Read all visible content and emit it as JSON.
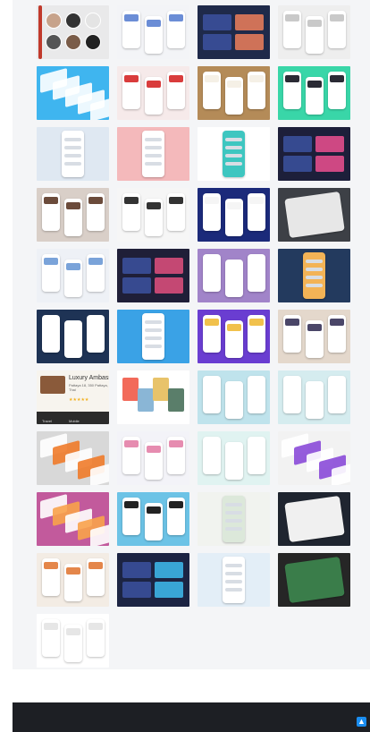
{
  "gallery": {
    "tiles": [
      {
        "name": "profile-circles-shot",
        "bg": "#e9e9ea",
        "accent": "#2a2a2a",
        "style": "circles"
      },
      {
        "name": "travel-cards-white-shot",
        "bg": "#f3f4f7",
        "accent": "#6b8dd6",
        "style": "phones"
      },
      {
        "name": "dark-mountain-app-shot",
        "bg": "#1f2a4a",
        "accent": "#e27a5a",
        "style": "dark"
      },
      {
        "name": "light-list-app-shot",
        "bg": "#eeeeee",
        "accent": "#c9c9c9",
        "style": "phones"
      },
      {
        "name": "blue-isometric-app-shot",
        "bg": "#3fb5ef",
        "accent": "#ffffff",
        "style": "iso"
      },
      {
        "name": "red-header-app-shot",
        "bg": "#f6eaea",
        "accent": "#d93c3c",
        "style": "phones"
      },
      {
        "name": "wood-desk-phone-shot",
        "bg": "#b48b58",
        "accent": "#f5f0e6",
        "style": "phones"
      },
      {
        "name": "green-travel-app-shot",
        "bg": "#39d6a8",
        "accent": "#2b2b35",
        "style": "phones"
      },
      {
        "name": "pale-blue-single-phone-shot",
        "bg": "#dfe8f2",
        "accent": "#ffffff",
        "style": "single"
      },
      {
        "name": "pink-london-app-shot",
        "bg": "#f4b9bb",
        "accent": "#ffffff",
        "style": "single"
      },
      {
        "name": "white-map-app-shot",
        "bg": "#ffffff",
        "accent": "#3ec6c0",
        "style": "single"
      },
      {
        "name": "dark-city-cards-shot",
        "bg": "#1d1f3a",
        "accent": "#e24d8c",
        "style": "dark"
      },
      {
        "name": "photo-collage-phones-shot",
        "bg": "#d9cfc8",
        "accent": "#6b4b3b",
        "style": "phones"
      },
      {
        "name": "white-ui-cards-shot",
        "bg": "#f6f6f6",
        "accent": "#333333",
        "style": "phones"
      },
      {
        "name": "dark-blue-screens-shot",
        "bg": "#1b2a7a",
        "accent": "#f5f5f5",
        "style": "phones"
      },
      {
        "name": "tablet-dark-perspective-shot",
        "bg": "#3d4046",
        "accent": "#e7e7e7",
        "style": "tablet"
      },
      {
        "name": "light-minimal-phones-shot",
        "bg": "#eef1f6",
        "accent": "#7aa3d9",
        "style": "phones"
      },
      {
        "name": "dark-pink-header-shot",
        "bg": "#1f1f38",
        "accent": "#d64d7a",
        "style": "dark"
      },
      {
        "name": "purple-phone-pair-shot",
        "bg": "#a184c9",
        "accent": "#ffffff",
        "style": "phones"
      },
      {
        "name": "blue-night-city-shot",
        "bg": "#233a5e",
        "accent": "#f3b356",
        "style": "single"
      },
      {
        "name": "navy-white-phones-shot",
        "bg": "#1e3355",
        "accent": "#ffffff",
        "style": "phones"
      },
      {
        "name": "hand-holding-phone-shot",
        "bg": "#3aa2e6",
        "accent": "#ffffff",
        "style": "single"
      },
      {
        "name": "purple-colorful-blocks-shot",
        "bg": "#6a3dd1",
        "accent": "#f1c14c",
        "style": "phones"
      },
      {
        "name": "beige-cards-shot",
        "bg": "#e4d8cc",
        "accent": "#4a4668",
        "style": "phones"
      },
      {
        "name": "luxury-ambassador-shot",
        "bg": "#f7f4ee",
        "accent": "#333333",
        "style": "luxury"
      },
      {
        "name": "coral-photo-collage-shot",
        "bg": "#ffffff",
        "accent": "#f05a5a",
        "style": "collage"
      },
      {
        "name": "teal-island-app-shot",
        "bg": "#bfe3ec",
        "accent": "#ffffff",
        "style": "phones"
      },
      {
        "name": "map-teal-app-shot",
        "bg": "#d5ecef",
        "accent": "#ffffff",
        "style": "phones"
      },
      {
        "name": "colorful-iso-cards-shot",
        "bg": "#d8d8d8",
        "accent": "#f07b2a",
        "style": "iso"
      },
      {
        "name": "pink-white-cards-shot",
        "bg": "#f3f3f8",
        "accent": "#e68cb0",
        "style": "phones"
      },
      {
        "name": "white-mint-phones-shot",
        "bg": "#e0f3f1",
        "accent": "#ffffff",
        "style": "phones"
      },
      {
        "name": "purple-iso-grid-shot",
        "bg": "#f2f2f2",
        "accent": "#8a4ad8",
        "style": "iso"
      },
      {
        "name": "colorful-gradient-cards-shot",
        "bg": "#c25a9c",
        "accent": "#f8a24b",
        "style": "iso"
      },
      {
        "name": "light-blue-two-phones-shot",
        "bg": "#6cc3e6",
        "accent": "#222222",
        "style": "phones"
      },
      {
        "name": "white-palm-phone-shot",
        "bg": "#f1f3ef",
        "accent": "#dce8da",
        "style": "single"
      },
      {
        "name": "dark-laptop-shot",
        "bg": "#1f2530",
        "accent": "#f0f0f0",
        "style": "tablet"
      },
      {
        "name": "sunset-phones-shot",
        "bg": "#f3ece4",
        "accent": "#e4864a",
        "style": "phones"
      },
      {
        "name": "dark-multi-cards-shot",
        "bg": "#1c2443",
        "accent": "#3db4e6",
        "style": "dark"
      },
      {
        "name": "pale-blue-phone-shot",
        "bg": "#e3eef7",
        "accent": "#ffffff",
        "style": "single"
      },
      {
        "name": "black-green-phone-shot",
        "bg": "#262626",
        "accent": "#3a7d4a",
        "style": "tablet"
      },
      {
        "name": "white-two-phones-shot",
        "bg": "#ffffff",
        "accent": "#e6e6e6",
        "style": "phones"
      }
    ],
    "luxury": {
      "title": "Luxury Ambass",
      "address": "Pattaya 18, 350\nPattaya, Thai",
      "stars": "★★★★★",
      "nav": [
        "Travel",
        "Mobile"
      ]
    }
  },
  "footer": {
    "top_button_icon": "arrow-up-icon",
    "top_button_glyph": "▲"
  }
}
